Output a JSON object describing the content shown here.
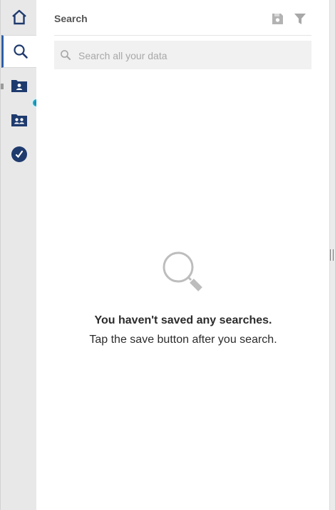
{
  "rail": {
    "items": [
      {
        "name": "home",
        "icon": "home-icon"
      },
      {
        "name": "search",
        "icon": "search-icon",
        "active": true
      },
      {
        "name": "folder-person",
        "icon": "folder-person-icon"
      },
      {
        "name": "folder-people",
        "icon": "folder-people-icon"
      },
      {
        "name": "check",
        "icon": "check-circle-icon"
      }
    ],
    "accent": "#2f5fa7",
    "icon_color": "#1f3b6e"
  },
  "header": {
    "title": "Search",
    "save_icon": "save-search-icon",
    "filter_icon": "filter-icon"
  },
  "search": {
    "placeholder": "Search all your data",
    "value": ""
  },
  "empty_state": {
    "icon": "magnifier-icon",
    "title": "You haven't saved any searches.",
    "subtitle": "Tap the save button after you search."
  }
}
